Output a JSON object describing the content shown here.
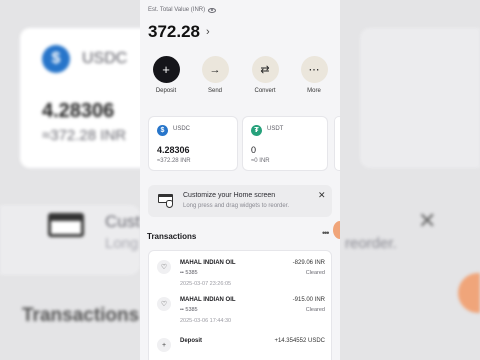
{
  "backdrop": {
    "coin_name": "USDC",
    "amount": "4.28306",
    "fiat": "≈372.28 INR",
    "banner_title": "Cust",
    "banner_sub": "Long",
    "banner_sub_right": "reorder.",
    "tx_title": "Transactions"
  },
  "header": {
    "total_label": "Est. Total Value (INR)",
    "total_value": "372.28"
  },
  "actions": [
    {
      "label": "Deposit",
      "glyph": "+"
    },
    {
      "label": "Send",
      "glyph": "→"
    },
    {
      "label": "Convert",
      "glyph": "⇄"
    },
    {
      "label": "More",
      "glyph": "⋯"
    }
  ],
  "assets": [
    {
      "name": "USDC",
      "symbol": "$",
      "amount": "4.28306",
      "fiat": "≈372.28 INR",
      "color": "#2775ca"
    },
    {
      "name": "USDT",
      "symbol": "₮",
      "amount": "0",
      "fiat": "≈0 INR",
      "color": "#26a17b"
    }
  ],
  "banner": {
    "title": "Customize your Home screen",
    "subtitle": "Long press and drag widgets to reorder."
  },
  "transactions": {
    "title": "Transactions",
    "items": [
      {
        "name": "MAHAL INDIAN OIL",
        "card": "•• 5385",
        "date": "2025-03-07 23:26:05",
        "amount": "-829.06 INR",
        "status": "Cleared",
        "icon": "card-icon"
      },
      {
        "name": "MAHAL INDIAN OIL",
        "card": "•• 5385",
        "date": "2025-03-06 17:44:30",
        "amount": "-915.00 INR",
        "status": "Cleared",
        "icon": "card-icon"
      },
      {
        "name": "Deposit",
        "card": "",
        "date": "",
        "amount": "+14.354552 USDC",
        "status": "",
        "icon": "plus-icon"
      }
    ]
  },
  "colors": {
    "accent_dark": "#15151a",
    "action_bg": "#ebe6dc",
    "orange": "#f0a57a"
  }
}
